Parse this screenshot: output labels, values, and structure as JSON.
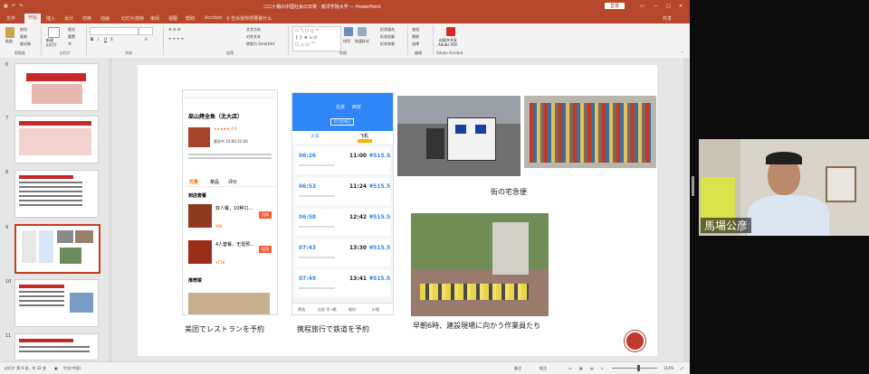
{
  "titlebar": {
    "doc_title": "コロナ禍の中国社会の日常 · 南洋学院大学 — PowerPoint",
    "login": "登录",
    "qat": [
      "文件",
      "撤销",
      "重做",
      "保存"
    ]
  },
  "tabs": [
    "文件",
    "开始",
    "插入",
    "设计",
    "切换",
    "动画",
    "幻灯片放映",
    "审阅",
    "视图",
    "帮助",
    "Acrobat",
    "♀ 告诉我你想要做什么"
  ],
  "share_label": "共享",
  "ribbon": {
    "groups": [
      "剪贴板",
      "幻灯片",
      "字体",
      "段落",
      "绘图",
      "编辑",
      "Adobe Acrobat"
    ],
    "buttons": {
      "paste": "粘贴",
      "cut": "剪切",
      "copy": "复制",
      "format_painter": "格式刷",
      "new_slide": "新建\n幻灯片",
      "layout": "版式",
      "reset": "重置",
      "section": "节",
      "shape_fill": "形状填充",
      "shape_outline": "形状轮廓",
      "shape_effects": "形状效果",
      "arrange": "排列",
      "quick_styles": "快速样式",
      "find": "查找",
      "replace": "替换",
      "select": "选择",
      "adobe": "创建并共享\nAdobe PDF",
      "text_direction": "文字方向",
      "align_text": "对齐文本",
      "smartart": "转换为 SmartArt"
    }
  },
  "thumbnails": [
    {
      "num": "6"
    },
    {
      "num": "7"
    },
    {
      "num": "8"
    },
    {
      "num": "9",
      "selected": true
    },
    {
      "num": "10"
    },
    {
      "num": "11"
    }
  ],
  "slide": {
    "meituan": {
      "shop_name": "巫山烤全鱼（北大店）",
      "rating": "★★★★★ 4.6",
      "open_time": "营业中 10:00-22:00",
      "tabs": [
        "优惠",
        "菜品",
        "评价"
      ],
      "section": "到店套餐",
      "deal1": "双人餐，10种口…",
      "deal1_price": "¥98",
      "deal2": "4人套餐，无需预…",
      "deal2_price": "¥158",
      "recommend": "推荐菜",
      "buy": "抢购",
      "caption": "美团でレストランを予約"
    },
    "ctrip": {
      "route_from": "北京",
      "route_to": "西安",
      "date": "07月08日",
      "mode_train": "火车",
      "mode_flight": "飞机",
      "rows": [
        {
          "dep": "06:26",
          "arr": "11:00",
          "price": "¥515.5"
        },
        {
          "dep": "06:53",
          "arr": "11:24",
          "price": "¥515.5"
        },
        {
          "dep": "06:58",
          "arr": "12:42",
          "price": "¥515.5"
        },
        {
          "dep": "07:43",
          "arr": "13:30",
          "price": "¥515.5"
        },
        {
          "dep": "07:49",
          "arr": "13:41",
          "price": "¥515.5"
        }
      ],
      "bottom_nav": [
        "筛选",
        "出发 早→晚",
        "耗时",
        "价格"
      ],
      "caption": "携程旅行で鉄道を予約"
    },
    "caption_delivery": "街の宅急便",
    "caption_workers": "早朝6時、建設現場に向かう作業員たち"
  },
  "status": {
    "slide_pos": "幻灯片 第 9 张，共 32 张",
    "lang": "中文(中国)",
    "notes": "备注",
    "comments": "批注",
    "zoom": "114%"
  },
  "camera": {
    "name": "馬場公彦"
  },
  "colors": {
    "accent": "#b7472a",
    "meituan": "#ffc300",
    "ctrip": "#2f86f6",
    "price_blue": "#2f86f6"
  }
}
